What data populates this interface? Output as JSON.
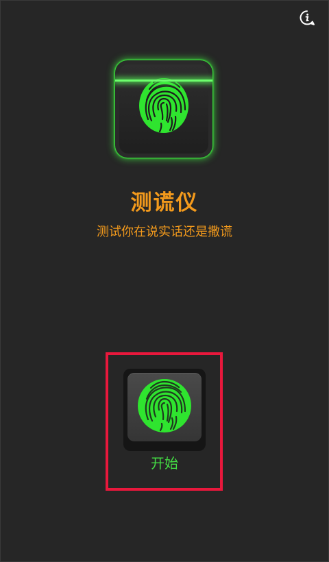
{
  "header": {
    "info_icon": "info-icon"
  },
  "hero": {
    "icon": "fingerprint-scanner-icon",
    "title": "测谎仪",
    "subtitle": "测试你在说实话还是撒谎"
  },
  "action": {
    "icon": "fingerprint-icon",
    "start_label": "开始"
  },
  "colors": {
    "background": "#262626",
    "accent_orange": "#f39a1c",
    "fingerprint_green": "#2fe42f",
    "highlight_red": "#e8183c"
  }
}
